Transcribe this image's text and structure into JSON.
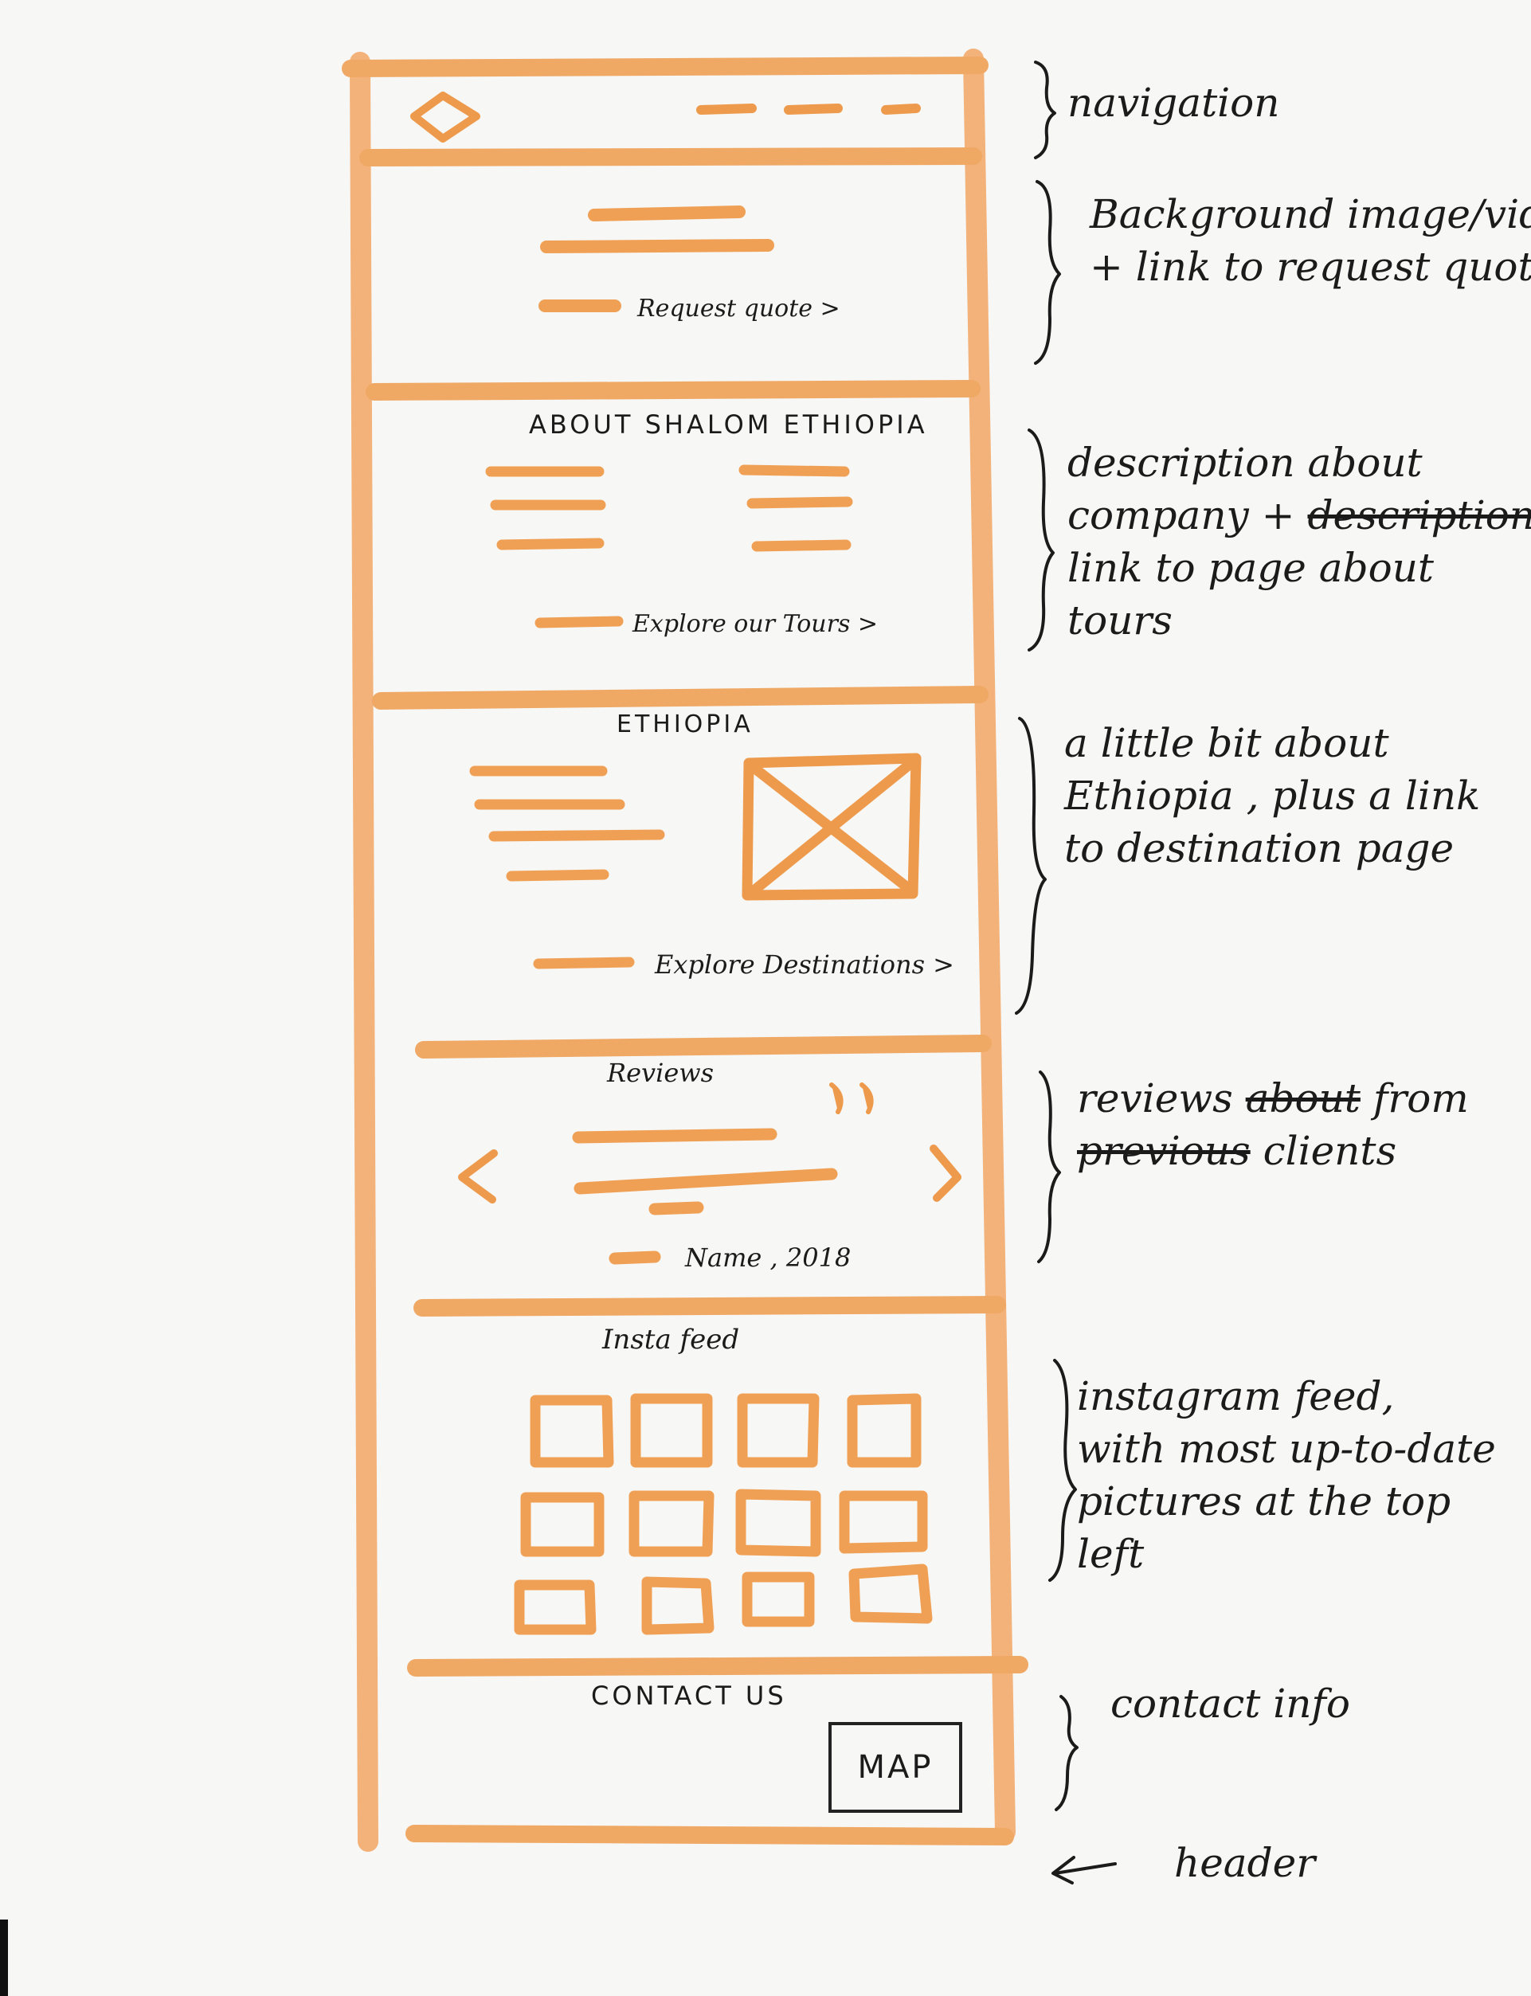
{
  "sections": {
    "hero": {
      "link": "Request quote >"
    },
    "about": {
      "title": "ABOUT  SHALOM  ETHIOPIA",
      "link": "Explore our Tours >"
    },
    "ethiopia": {
      "title": "ETHIOPIA",
      "link": "Explore Destinations >"
    },
    "reviews": {
      "title": "Reviews",
      "quote_mark": "”",
      "attribution": "Name , 2018",
      "prev_arrow": "<",
      "next_arrow": ">"
    },
    "insta": {
      "title": "Insta  feed"
    },
    "contact": {
      "title": "CONTACT  US",
      "map": "MAP"
    }
  },
  "annotations": {
    "navigation": "navigation",
    "hero": [
      "Background image/video",
      "+ link to request quote"
    ],
    "about": [
      "description about",
      "company +",
      "description",
      "link to page about",
      "tours"
    ],
    "ethiopia": [
      "a little bit about",
      "Ethiopia , plus a link",
      "to destination page"
    ],
    "reviews": [
      "reviews",
      "about",
      "from",
      "previous",
      "clients"
    ],
    "insta": [
      "instagram feed,",
      "with most up-to-date",
      "pictures at the top",
      "left"
    ],
    "contact": "contact info",
    "footer": "header"
  },
  "colors": {
    "marker": "#f0a055",
    "marker_light": "#f6c39a",
    "marker_strong": "#ec8f3e",
    "ink": "#1b1b1b"
  }
}
